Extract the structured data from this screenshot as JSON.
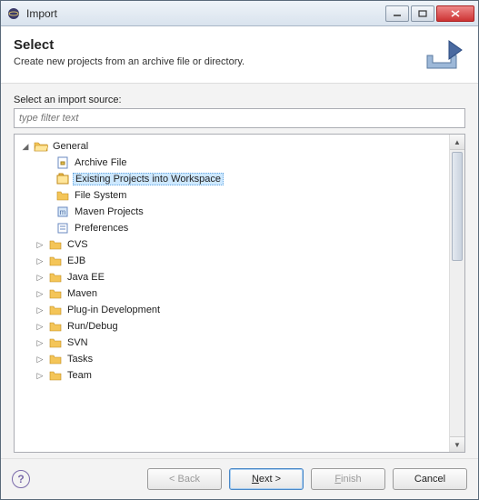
{
  "window": {
    "title": "Import"
  },
  "banner": {
    "title": "Select",
    "description": "Create new projects from an archive file or directory."
  },
  "source_label": "Select an import source:",
  "filter_placeholder": "type filter text",
  "tree": {
    "expanded": {
      "label": "General",
      "children": [
        {
          "label": "Archive File",
          "icon": "archive"
        },
        {
          "label": "Existing Projects into Workspace",
          "icon": "projects",
          "selected": true
        },
        {
          "label": "File System",
          "icon": "folder"
        },
        {
          "label": "Maven Projects",
          "icon": "maven"
        },
        {
          "label": "Preferences",
          "icon": "prefs"
        }
      ]
    },
    "collapsed": [
      "CVS",
      "EJB",
      "Java EE",
      "Maven",
      "Plug-in Development",
      "Run/Debug",
      "SVN",
      "Tasks",
      "Team"
    ]
  },
  "buttons": {
    "back": "< Back",
    "next_prefix": "N",
    "next_suffix": "ext >",
    "finish_prefix": "F",
    "finish_suffix": "inish",
    "cancel": "Cancel"
  }
}
